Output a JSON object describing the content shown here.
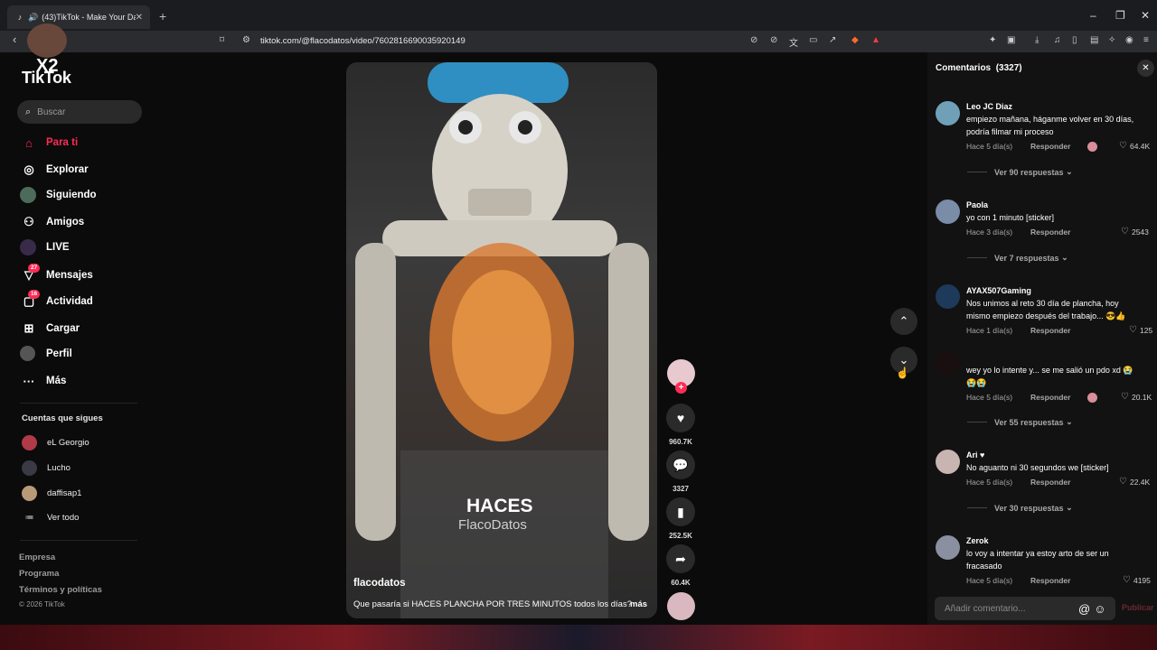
{
  "browser": {
    "tab_title": "(43)TikTok - Make Your Day",
    "url": "tiktok.com/@flacodatos/video/7602816690035920149"
  },
  "sidebar": {
    "logo": "TikTok",
    "overlay_text": "X2",
    "search_placeholder": "Buscar",
    "nav": [
      {
        "label": "Para ti",
        "icon": "home-icon",
        "active": true
      },
      {
        "label": "Explorar",
        "icon": "compass-icon"
      },
      {
        "label": "Siguiendo",
        "icon": "following-avatar-icon"
      },
      {
        "label": "Amigos",
        "icon": "friends-icon"
      },
      {
        "label": "LIVE",
        "icon": "live-icon"
      },
      {
        "label": "Mensajes",
        "icon": "message-icon",
        "badge": "27"
      },
      {
        "label": "Actividad",
        "icon": "activity-icon",
        "badge": "16"
      },
      {
        "label": "Cargar",
        "icon": "upload-icon"
      },
      {
        "label": "Perfil",
        "icon": "profile-icon"
      },
      {
        "label": "Más",
        "icon": "more-icon"
      }
    ],
    "following_header": "Cuentas que sigues",
    "following": [
      "eL Georgio",
      "Lucho",
      "daffisap1"
    ],
    "see_all": "Ver todo",
    "footer": [
      "Empresa",
      "Programa",
      "Términos y políticas"
    ],
    "copyright": "© 2026 TikTok"
  },
  "video": {
    "caption": "HACES",
    "watermark": "FlacoDatos",
    "username": "flacodatos",
    "description": "Que pasaría si HACES PLANCHA POR TRES MINUTOS todos los días?",
    "more": "más",
    "likes": "960.7K",
    "comments": "3327",
    "saves": "252.5K",
    "shares": "60.4K"
  },
  "comments": {
    "title": "Comentarios",
    "count": "(3327)",
    "reply_label": "Responder",
    "input_placeholder": "Añadir comentario...",
    "publish": "Publicar",
    "items": [
      {
        "name": "Leo JC Diaz",
        "text": "empiezo mañana, háganme volver en 30 días, podría filmar mi proceso",
        "time": "Hace 5 día(s)",
        "likes": "64.4K",
        "replies": "Ver 90 respuestas"
      },
      {
        "name": "Paola",
        "text": "yo con 1 minuto [sticker]",
        "time": "Hace 3 día(s)",
        "likes": "2543",
        "replies": "Ver 7 respuestas"
      },
      {
        "name": "AYAX507Gaming",
        "text": "Nos unimos al reto 30 día de plancha, hoy mismo empiezo después del trabajo... 😎👍",
        "time": "Hace 1 día(s)",
        "likes": "125"
      },
      {
        "name": "",
        "text": "wey yo lo intente y... se me salió un pdo xd 😭 😭😭",
        "time": "Hace 5 día(s)",
        "likes": "20.1K",
        "replies": "Ver 55 respuestas"
      },
      {
        "name": "Ari ♥",
        "text": "No aguanto ni 30 segundos we [sticker]",
        "time": "Hace 5 día(s)",
        "likes": "22.4K",
        "replies": "Ver 30 respuestas"
      },
      {
        "name": "Zerok",
        "text": "lo voy a intentar ya estoy arto de ser un fracasado",
        "time": "Hace 5 día(s)",
        "likes": "4195"
      }
    ]
  },
  "colors": {
    "accent": "#fe2c55",
    "panel": "#121212",
    "background": "#0b0b0b"
  }
}
